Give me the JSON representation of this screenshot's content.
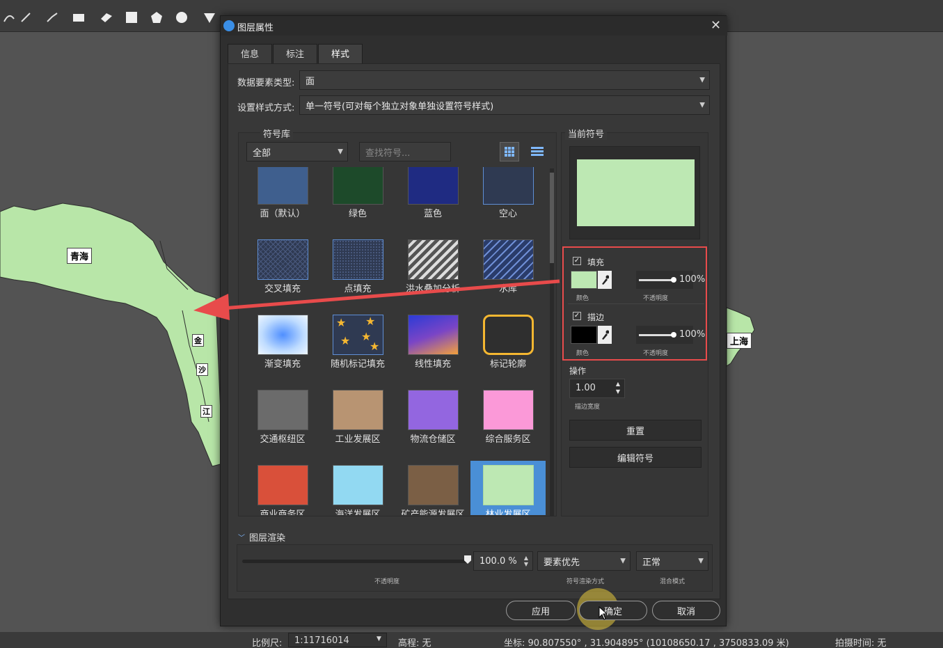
{
  "dialog": {
    "title": "图层属性",
    "tabs": [
      "信息",
      "标注",
      "样式"
    ],
    "feature_type_label": "数据要素类型:",
    "feature_type_value": "面",
    "style_mode_label": "设置样式方式:",
    "style_mode_value": "单一符号(可对每个独立对象单独设置符号样式)"
  },
  "library": {
    "title": "符号库",
    "filter_value": "全部",
    "search_placeholder": "查找符号...",
    "symbols": [
      {
        "label": "面（默认）",
        "color": "#3f5f8e"
      },
      {
        "label": "绿色",
        "color": "#1d4a2a"
      },
      {
        "label": "蓝色",
        "color": "#1f2b82"
      },
      {
        "label": "空心",
        "color": "#2f3a52"
      },
      {
        "label": "交叉填充",
        "color": "#2f3a52"
      },
      {
        "label": "点填充",
        "color": "#2f3a52"
      },
      {
        "label": "洪水叠加分析",
        "color": "#555555"
      },
      {
        "label": "水库",
        "color": "#2a3c6a"
      },
      {
        "label": "渐变填充",
        "color": "#7fb2ff"
      },
      {
        "label": "随机标记填充",
        "color": "#2f3a52"
      },
      {
        "label": "线性填充",
        "color": "#6a3fbf"
      },
      {
        "label": "标记轮廓",
        "color": "#2f2f2f"
      },
      {
        "label": "交通枢纽区",
        "color": "#6b6b6b"
      },
      {
        "label": "工业发展区",
        "color": "#b89472"
      },
      {
        "label": "物流仓储区",
        "color": "#9366e0"
      },
      {
        "label": "综合服务区",
        "color": "#fb99d8"
      },
      {
        "label": "商业商务区",
        "color": "#d9503a"
      },
      {
        "label": "海洋发展区",
        "color": "#92d9f2"
      },
      {
        "label": "矿产能源发展区",
        "color": "#7b5f45"
      },
      {
        "label": "林业发展区",
        "color": "#bde8b3"
      }
    ]
  },
  "current_symbol": {
    "title": "当前符号",
    "preview_color": "#bde8b3",
    "fill_label": "填充",
    "fill_color": "#bde8b3",
    "fill_opacity": "100%",
    "fill_opacity_value": 100,
    "color_caption": "颜色",
    "opacity_caption": "不透明度",
    "stroke_label": "描边",
    "stroke_color": "#000000",
    "stroke_opacity": "100%",
    "stroke_opacity_value": 100,
    "ops_title": "操作",
    "stroke_width": "1.00",
    "stroke_width_caption": "描边宽度",
    "reset_label": "重置",
    "edit_label": "编辑符号"
  },
  "render": {
    "title": "图层渲染",
    "opacity": "100.0 %",
    "opacity_caption": "不透明度",
    "order_value": "要素优先",
    "order_caption": "符号渲染方式",
    "blend_value": "正常",
    "blend_caption": "混合模式"
  },
  "footer": {
    "apply_label": "应用",
    "ok_label": "确定",
    "cancel_label": "取消"
  },
  "map": {
    "labels": [
      "青海",
      "上海",
      "金",
      "沙",
      "江"
    ],
    "land_color": "#b8e6a8"
  },
  "status": {
    "scale_label": "比例尺:",
    "scale_value": "1:11716014",
    "elevation": "高程: 无",
    "coords": "坐标: 90.807550° , 31.904895°  (10108650.17 , 3750833.09 米)",
    "capture_time": "拍摄时间: 无"
  },
  "annotation": {
    "highlight_color": "#e84b4b"
  }
}
